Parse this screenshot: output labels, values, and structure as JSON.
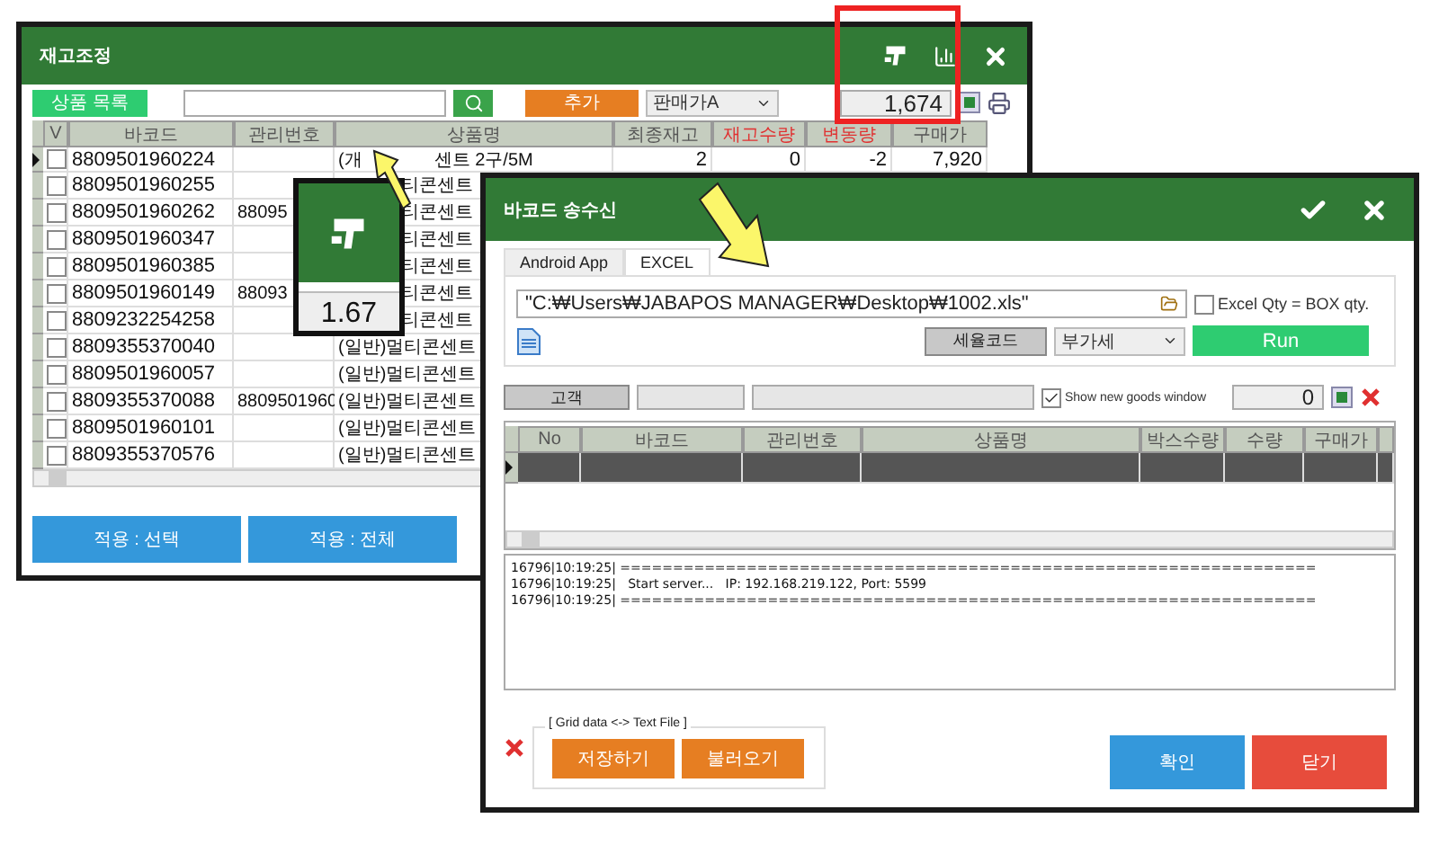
{
  "background_window": {
    "title": "재고조정",
    "toolbar": {
      "product_list_button": "상품 목록",
      "add_button": "추가",
      "price_select": "판매가A",
      "total": "1,674"
    },
    "table": {
      "columns": [
        {
          "label": "V",
          "alert": false
        },
        {
          "label": "바코드",
          "alert": false
        },
        {
          "label": "관리번호",
          "alert": false
        },
        {
          "label": "상품명",
          "alert": false
        },
        {
          "label": "최종재고",
          "alert": false
        },
        {
          "label": "재고수량",
          "alert": true
        },
        {
          "label": "변동량",
          "alert": true
        },
        {
          "label": "구매가",
          "alert": false
        }
      ],
      "rows": [
        {
          "selected": true,
          "checked": false,
          "barcode": "8809501960224",
          "name": "(개",
          "name_tail": "센트 2구/5M",
          "final_stock": "2",
          "stock_qty": "0",
          "change": "-2",
          "price": "7,920"
        },
        {
          "selected": false,
          "checked": false,
          "barcode": "8809501960255",
          "name": "티콘센트"
        },
        {
          "selected": false,
          "checked": false,
          "barcode": "8809501960262",
          "code": "88095",
          "name": "티콘센트"
        },
        {
          "selected": false,
          "checked": false,
          "barcode": "8809501960347",
          "name": "티콘센트"
        },
        {
          "selected": false,
          "checked": false,
          "barcode": "8809501960385",
          "name": "티콘센트"
        },
        {
          "selected": false,
          "checked": false,
          "barcode": "8809501960149",
          "code": "88093",
          "name": "티콘센트"
        },
        {
          "selected": false,
          "checked": false,
          "barcode": "8809232254258",
          "name": "티콘센트"
        },
        {
          "selected": false,
          "checked": false,
          "barcode": "8809355370040",
          "name": "(일반)멀티콘센트"
        },
        {
          "selected": false,
          "checked": false,
          "barcode": "8809501960057",
          "name": "(일반)멀티콘센트"
        },
        {
          "selected": false,
          "checked": false,
          "barcode": "8809355370088",
          "code": "8809501960",
          "name": "(일반)멀티콘센트"
        },
        {
          "selected": false,
          "checked": false,
          "barcode": "8809501960101",
          "name": "(일반)멀티콘센트"
        },
        {
          "selected": false,
          "checked": false,
          "barcode": "8809355370576",
          "name": "(일반)멀티콘센트"
        }
      ]
    },
    "buttons": [
      "적용 : 선택",
      "적용 : 전체"
    ]
  },
  "zoom_inset": {
    "value": "1.67"
  },
  "dialog": {
    "title": "바코드 송수신",
    "tabs": [
      {
        "label": "Android App",
        "selected": false
      },
      {
        "label": "EXCEL",
        "selected": true
      }
    ],
    "file_path": "\"C:₩Users₩JABAPOS MANAGER₩Desktop₩1002.xls\"",
    "box_qty": {
      "label": "Excel Qty = BOX qty.",
      "checked": false
    },
    "tax_code_button": "세율코드",
    "tax_select": "부가세",
    "run_button": "Run",
    "customer_button": "고객",
    "new_goods": {
      "label": "Show new goods window",
      "checked": true
    },
    "count": "0",
    "grid": {
      "columns": [
        "No",
        "바코드",
        "관리번호",
        "상품명",
        "박스수량",
        "수량",
        "구매가"
      ],
      "rows": [
        {
          "selected": true
        }
      ]
    },
    "log": [
      "16796|10:19:25| ==================================================================",
      "16796|10:19:25|   Start server...   IP: 192.168.219.122, Port: 5599",
      "16796|10:19:25| =================================================================="
    ],
    "file_group": {
      "legend": "[ Grid data <-> Text File ]",
      "buttons": [
        "저장하기",
        "불러오기"
      ]
    },
    "confirm_button": "확인",
    "close_button": "닫기"
  }
}
